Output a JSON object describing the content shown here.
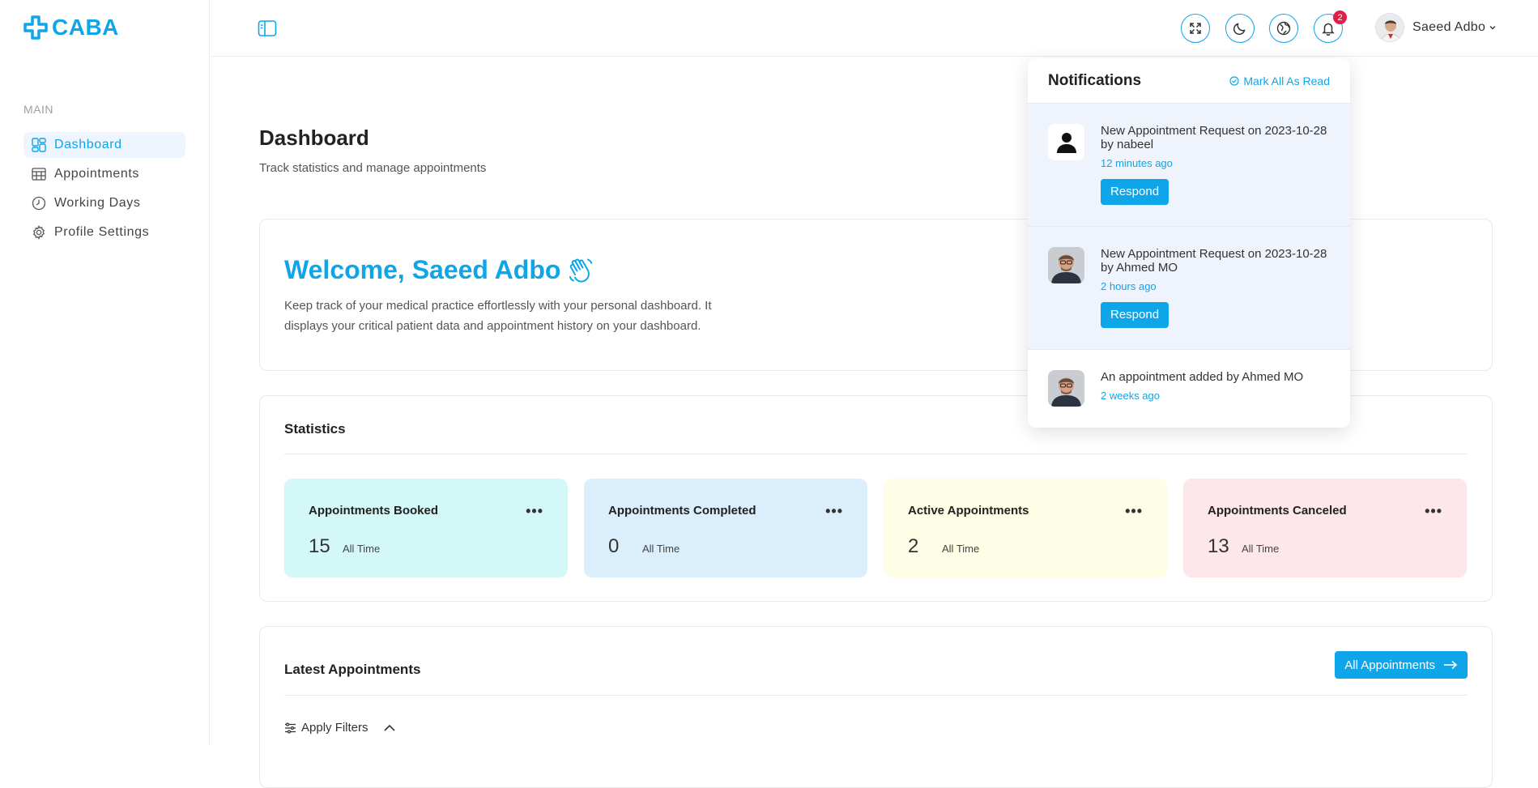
{
  "brand": {
    "name": "CABA",
    "color": "#0ea5e9"
  },
  "sidebar": {
    "section": "MAIN",
    "items": [
      {
        "label": "Dashboard",
        "icon": "dashboard-icon",
        "active": true
      },
      {
        "label": "Appointments",
        "icon": "calendar-icon"
      },
      {
        "label": "Working Days",
        "icon": "clock-icon"
      },
      {
        "label": "Profile Settings",
        "icon": "gear-icon"
      }
    ]
  },
  "topbar": {
    "notification_count": "2",
    "user_name": "Saeed Adbo"
  },
  "page": {
    "title": "Dashboard",
    "subtitle": "Track statistics and manage appointments"
  },
  "welcome": {
    "title": "Welcome, Saeed Adbo",
    "text": "Keep track of your medical practice effortlessly with your personal dashboard. It displays your critical patient data and appointment history on your dashboard."
  },
  "statistics": {
    "title": "Statistics",
    "cards": [
      {
        "label": "Appointments Booked",
        "value": "15",
        "period": "All Time",
        "color": "#d4f7f8"
      },
      {
        "label": "Appointments Completed",
        "value": "0",
        "period": "All Time",
        "color": "#dbeefb"
      },
      {
        "label": "Active Appointments",
        "value": "2",
        "period": "All Time",
        "color": "#fefde6"
      },
      {
        "label": "Appointments Canceled",
        "value": "13",
        "period": "All Time",
        "color": "#fde7ea"
      }
    ]
  },
  "latest": {
    "title": "Latest Appointments",
    "button": "All Appointments",
    "filters": "Apply Filters"
  },
  "notifications": {
    "title": "Notifications",
    "mark_all": "Mark All As Read",
    "items": [
      {
        "text": "New Appointment Request on 2023-10-28 by nabeel",
        "time": "12 minutes ago",
        "action": "Respond"
      },
      {
        "text": "New Appointment Request on 2023-10-28 by Ahmed MO",
        "time": "2 hours ago",
        "action": "Respond"
      },
      {
        "text": "An appointment added by Ahmed MO",
        "time": "2 weeks ago"
      }
    ]
  }
}
